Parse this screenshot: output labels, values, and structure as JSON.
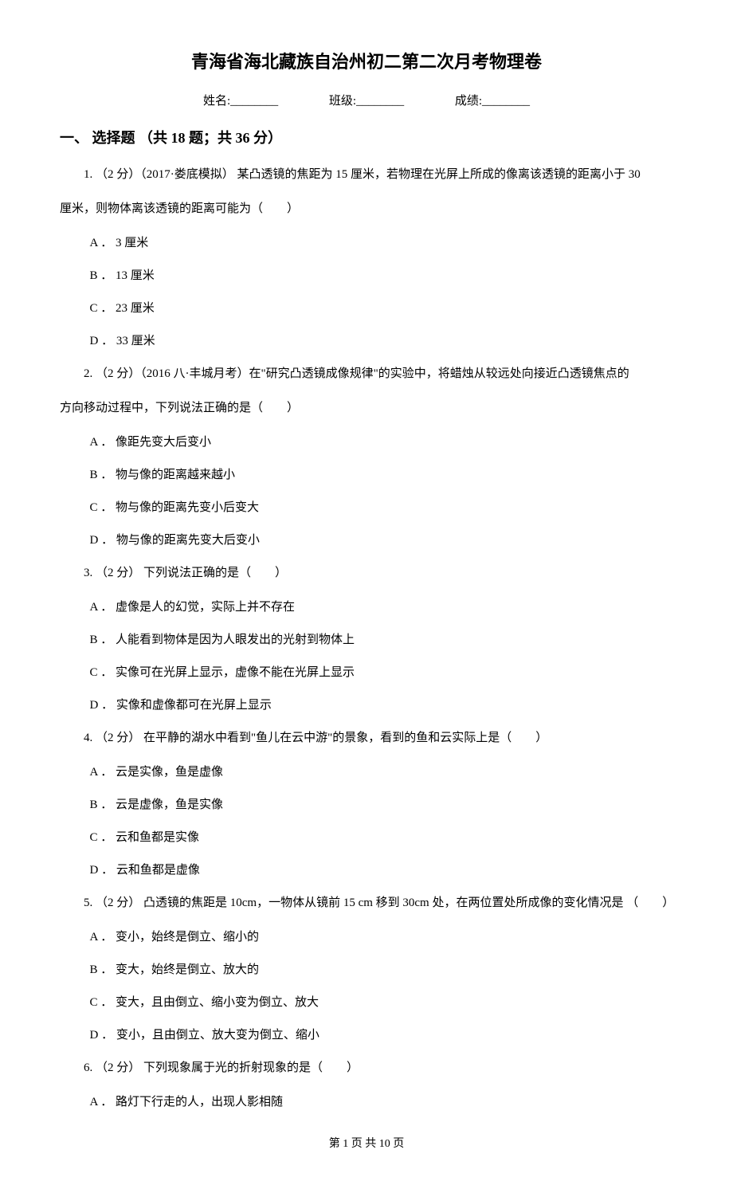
{
  "title": "青海省海北藏族自治州初二第二次月考物理卷",
  "info": {
    "name_label": "姓名:________",
    "class_label": "班级:________",
    "score_label": "成绩:________"
  },
  "section_heading": "一、 选择题 （共 18 题；共 36 分）",
  "questions": [
    {
      "stem": "1. （2 分）（2017·娄底模拟） 某凸透镜的焦距为 15 厘米，若物理在光屏上所成的像离该透镜的距离小于 30",
      "stem_cont": "厘米，则物体离该透镜的距离可能为（　　）",
      "options": [
        "A ． 3 厘米",
        "B ． 13 厘米",
        "C ． 23 厘米",
        "D ． 33 厘米"
      ]
    },
    {
      "stem": "2. （2 分）（2016 八·丰城月考）在\"研究凸透镜成像规律\"的实验中，将蜡烛从较远处向接近凸透镜焦点的",
      "stem_cont": "方向移动过程中，下列说法正确的是（　　）",
      "options": [
        "A ． 像距先变大后变小",
        "B ． 物与像的距离越来越小",
        "C ． 物与像的距离先变小后变大",
        "D ． 物与像的距离先变大后变小"
      ]
    },
    {
      "stem": "3. （2 分）  下列说法正确的是（　　）",
      "options": [
        "A ． 虚像是人的幻觉，实际上并不存在",
        "B ． 人能看到物体是因为人眼发出的光射到物体上",
        "C ． 实像可在光屏上显示，虚像不能在光屏上显示",
        "D ． 实像和虚像都可在光屏上显示"
      ]
    },
    {
      "stem": "4. （2 分）  在平静的湖水中看到\"鱼儿在云中游\"的景象，看到的鱼和云实际上是（　　）",
      "options": [
        "A ． 云是实像，鱼是虚像",
        "B ． 云是虚像，鱼是实像",
        "C ． 云和鱼都是实像",
        "D ． 云和鱼都是虚像"
      ]
    },
    {
      "stem": "5. （2 分）  凸透镜的焦距是 10cm，一物体从镜前 15 cm 移到 30cm 处，在两位置处所成像的变化情况是 （　　）",
      "options": [
        "A ． 变小，始终是倒立、缩小的",
        "B ． 变大，始终是倒立、放大的",
        "C ． 变大，且由倒立、缩小变为倒立、放大",
        "D ． 变小，且由倒立、放大变为倒立、缩小"
      ]
    },
    {
      "stem": "6. （2 分）  下列现象属于光的折射现象的是（　　）",
      "options": [
        "A ． 路灯下行走的人，出现人影相随"
      ]
    }
  ],
  "footer": "第 1 页 共 10 页"
}
